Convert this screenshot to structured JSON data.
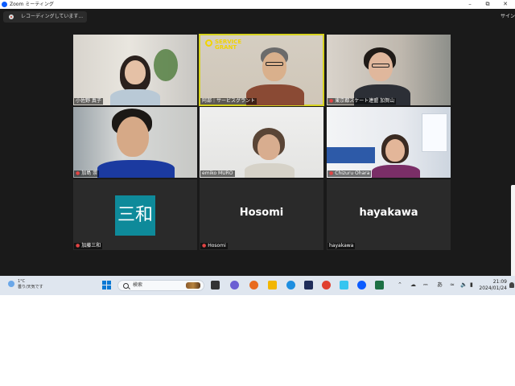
{
  "window": {
    "title": "Zoom ミーティング",
    "minimize": "–",
    "maximize": "⧉",
    "close": "✕"
  },
  "recording": {
    "text": "レコーディングしています..."
  },
  "signin": "サイン",
  "participants": [
    {
      "name": "小佐野 真子",
      "muted": false
    },
    {
      "name": "阿部｜サービスグラント",
      "muted": false,
      "active": true
    },
    {
      "name": "東京都スケート連盟 加賀山",
      "muted": true
    },
    {
      "name": "加島 崇",
      "muted": true
    },
    {
      "name": "emiko MURO",
      "muted": false
    },
    {
      "name": "Chizuru Ohara",
      "muted": true
    },
    {
      "name": "加藤三和",
      "muted": true,
      "avatar_text": "三和",
      "avatar_color": "#0e8a9a"
    },
    {
      "name": "Hosomi",
      "muted": true,
      "display_name": "Hosomi"
    },
    {
      "name": "hayakawa",
      "muted": false,
      "display_name": "hayakawa"
    }
  ],
  "service_grant_logo": {
    "line1": "SERVICE",
    "line2": "GRANT"
  },
  "taskbar": {
    "weather_temp": "1°C",
    "weather_text": "曇り/天気です",
    "search_placeholder": "検索",
    "clock_time": "21:09",
    "clock_date": "2024/01/24",
    "ime": "あ"
  },
  "colors": {
    "active_speaker": "#d6d21e",
    "zoom_blue": "#0b5cff",
    "muted_red": "#e24444"
  }
}
